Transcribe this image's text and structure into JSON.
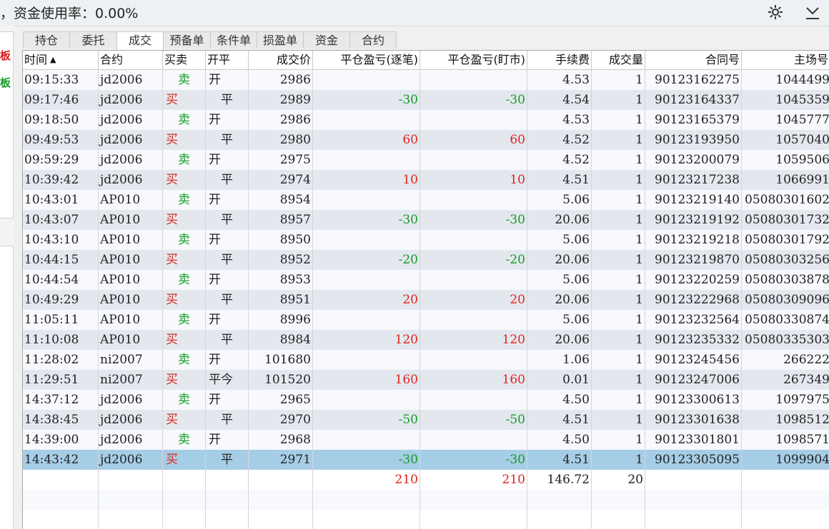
{
  "status_text": "，资金使用率：0.00%",
  "icons": {
    "settings": "gear-icon",
    "menu": "chevron-down-icon"
  },
  "left_labels": [
    "板",
    "板"
  ],
  "tabs": [
    "持仓",
    "委托",
    "成交",
    "预备单",
    "条件单",
    "损盈单",
    "资金",
    "合约"
  ],
  "active_tab": 2,
  "columns": [
    "时间",
    "合约",
    "买卖",
    "开平",
    "成交价",
    "平仓盈亏(逐笔)",
    "平仓盈亏(盯市)",
    "手续费",
    "成交量",
    "合同号",
    "主场号"
  ],
  "sort_indicator": "▲",
  "rows": [
    [
      "09:15:33",
      "jd2006",
      "卖",
      "开",
      "2986",
      "",
      "",
      "4.53",
      "1",
      "90123162275",
      "1044499"
    ],
    [
      "09:17:46",
      "jd2006",
      "买",
      "平",
      "2989",
      "-30",
      "-30",
      "4.54",
      "1",
      "90123164337",
      "1045359"
    ],
    [
      "09:18:50",
      "jd2006",
      "卖",
      "开",
      "2986",
      "",
      "",
      "4.53",
      "1",
      "90123165379",
      "1045777"
    ],
    [
      "09:49:53",
      "jd2006",
      "买",
      "平",
      "2980",
      "60",
      "60",
      "4.52",
      "1",
      "90123193950",
      "1057040"
    ],
    [
      "09:59:29",
      "jd2006",
      "卖",
      "开",
      "2975",
      "",
      "",
      "4.52",
      "1",
      "90123200079",
      "1059506"
    ],
    [
      "10:39:42",
      "jd2006",
      "买",
      "平",
      "2974",
      "10",
      "10",
      "4.51",
      "1",
      "90123217238",
      "1066991"
    ],
    [
      "10:43:01",
      "AP010",
      "卖",
      "开",
      "8954",
      "",
      "",
      "5.06",
      "1",
      "90123219140",
      "05080301602"
    ],
    [
      "10:43:07",
      "AP010",
      "买",
      "平",
      "8957",
      "-30",
      "-30",
      "20.06",
      "1",
      "90123219192",
      "05080301732"
    ],
    [
      "10:43:10",
      "AP010",
      "卖",
      "开",
      "8950",
      "",
      "",
      "5.06",
      "1",
      "90123219218",
      "05080301792"
    ],
    [
      "10:44:15",
      "AP010",
      "买",
      "平",
      "8952",
      "-20",
      "-20",
      "20.06",
      "1",
      "90123219870",
      "05080303256"
    ],
    [
      "10:44:54",
      "AP010",
      "卖",
      "开",
      "8953",
      "",
      "",
      "5.06",
      "1",
      "90123220259",
      "05080303878"
    ],
    [
      "10:49:29",
      "AP010",
      "买",
      "平",
      "8951",
      "20",
      "20",
      "20.06",
      "1",
      "90123222968",
      "05080309096"
    ],
    [
      "11:05:11",
      "AP010",
      "卖",
      "开",
      "8996",
      "",
      "",
      "5.06",
      "1",
      "90123232564",
      "05080330874"
    ],
    [
      "11:10:08",
      "AP010",
      "买",
      "平",
      "8984",
      "120",
      "120",
      "20.06",
      "1",
      "90123235332",
      "05080335303"
    ],
    [
      "11:28:02",
      "ni2007",
      "卖",
      "开",
      "101680",
      "",
      "",
      "1.06",
      "1",
      "90123245456",
      "266222"
    ],
    [
      "11:29:51",
      "ni2007",
      "买",
      "平今",
      "101520",
      "160",
      "160",
      "0.01",
      "1",
      "90123247006",
      "267349"
    ],
    [
      "14:37:12",
      "jd2006",
      "卖",
      "开",
      "2965",
      "",
      "",
      "4.50",
      "1",
      "90123300613",
      "1097975"
    ],
    [
      "14:38:45",
      "jd2006",
      "买",
      "平",
      "2970",
      "-50",
      "-50",
      "4.51",
      "1",
      "90123301638",
      "1098512"
    ],
    [
      "14:39:00",
      "jd2006",
      "卖",
      "开",
      "2968",
      "",
      "",
      "4.50",
      "1",
      "90123301801",
      "1098571"
    ],
    [
      "14:43:42",
      "jd2006",
      "买",
      "平",
      "2971",
      "-30",
      "-30",
      "4.51",
      "1",
      "90123305095",
      "1099904"
    ]
  ],
  "selected_row": 19,
  "summary": [
    "",
    "",
    "",
    "",
    "",
    "210",
    "210",
    "146.72",
    "20",
    "",
    ""
  ],
  "colors": {
    "buy": "#e0241b",
    "sell": "#169b27",
    "profit": "#e0241b",
    "loss": "#169b27",
    "selected": "#a6cde6"
  }
}
